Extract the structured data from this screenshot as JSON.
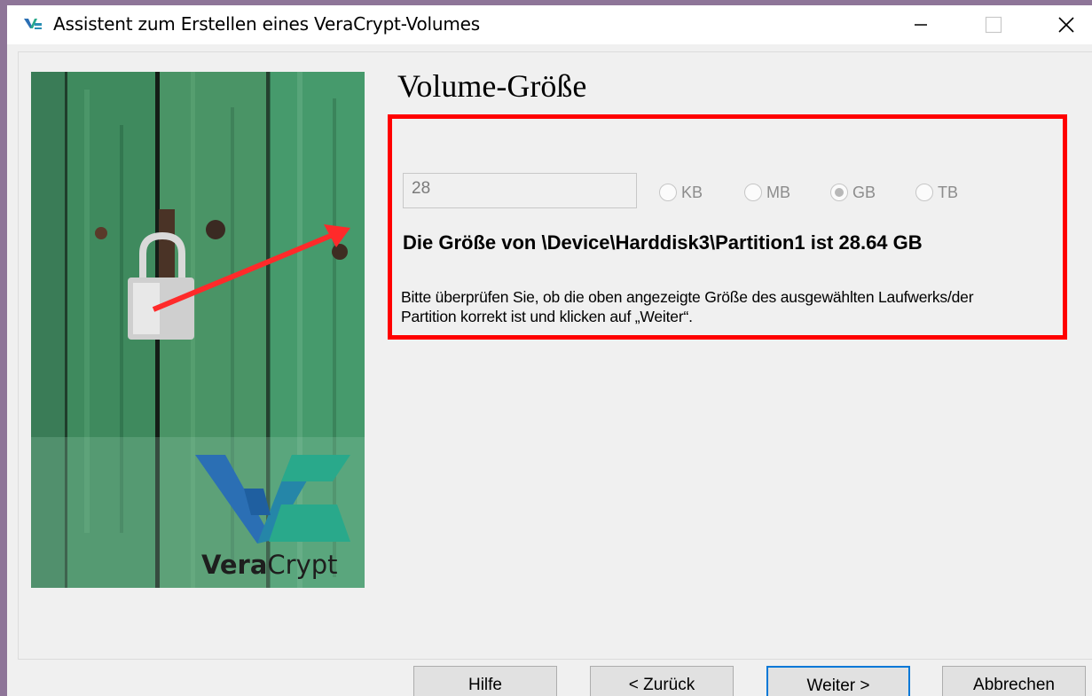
{
  "window": {
    "title": "Assistent zum Erstellen eines VeraCrypt-Volumes",
    "controls": [
      "minimize",
      "maximize",
      "close"
    ]
  },
  "sidebar": {
    "logo_text_bold": "Vera",
    "logo_text_light": "Crypt",
    "colors": {
      "door_green": "#3e8a5f",
      "logo_blue": "#2b6fb4",
      "logo_teal": "#29a98b",
      "arrow": "#ff2a2a"
    }
  },
  "page": {
    "heading": "Volume-Größe",
    "size_input": {
      "value": "28"
    },
    "units": [
      {
        "label": "KB",
        "selected": false
      },
      {
        "label": "MB",
        "selected": false
      },
      {
        "label": "GB",
        "selected": true
      },
      {
        "label": "TB",
        "selected": false
      }
    ],
    "size_info": "Die Größe von \\Device\\Harddisk3\\Partition1 ist 28.64 GB",
    "hint": "Bitte überprüfen Sie, ob die oben angezeigte Größe des ausgewählten Laufwerks/der\nPartition korrekt ist und klicken auf „Weiter“.",
    "highlight_color": "#ff0000"
  },
  "buttons": {
    "help": "Hilfe",
    "back": "< Zurück",
    "next": "Weiter >",
    "cancel": "Abbrechen"
  }
}
